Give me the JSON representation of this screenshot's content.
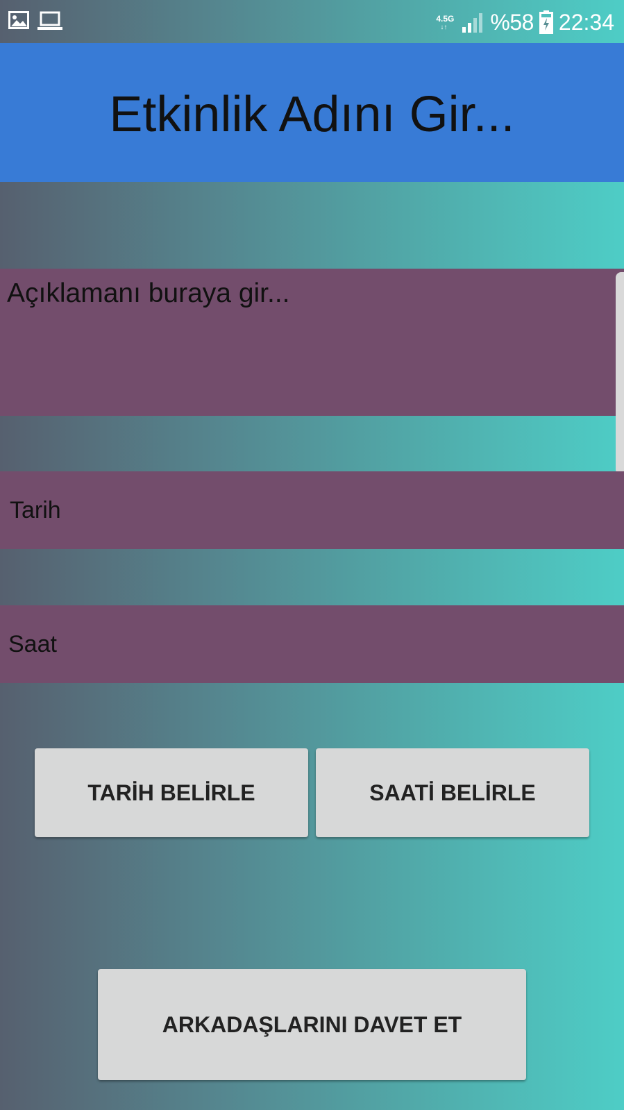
{
  "status_bar": {
    "left_icons": [
      "image-icon",
      "laptop-icon"
    ],
    "network_type": "4.5G",
    "network_arrows": "↓↑",
    "signal_icon": "signal-bars-icon",
    "battery_percent": "%58",
    "battery_icon": "battery-charging-icon",
    "time": "22:34"
  },
  "header": {
    "title": "Etkinlik Adını Gir..."
  },
  "form": {
    "description_placeholder": "Açıklamanı buraya gir...",
    "date_label": "Tarih",
    "time_label": "Saat"
  },
  "buttons": {
    "set_date": "TARİH BELİRLE",
    "set_time": "SAATİ BELİRLE",
    "invite_friends": "ARKADAŞLARINI DAVET ET"
  },
  "colors": {
    "header_bg": "#387bd6",
    "field_bg": "#734d6c",
    "button_bg": "#d7d8d8",
    "gradient_start": "#56606f",
    "gradient_end": "#4ecdc6"
  }
}
